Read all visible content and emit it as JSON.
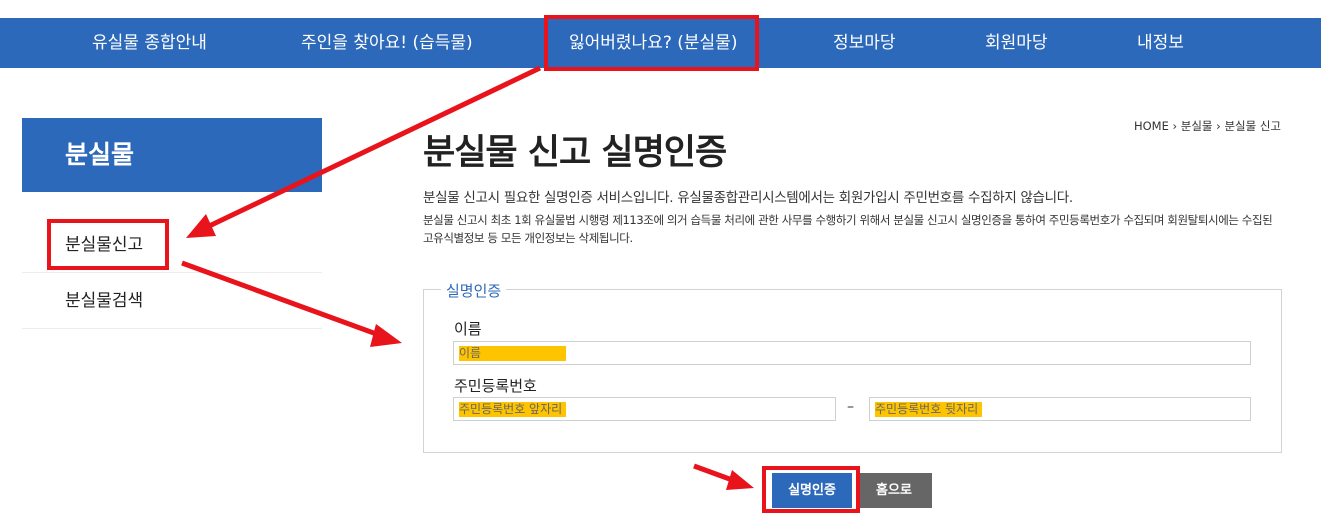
{
  "nav": {
    "items": [
      "유실물 종합안내",
      "주인을 찾아요! (습득물)",
      "잃어버렸나요? (분실물)",
      "정보마당",
      "회원마당",
      "내정보"
    ]
  },
  "sidebar": {
    "title": "분실물",
    "items": [
      "분실물신고",
      "분실물검색"
    ]
  },
  "breadcrumb": {
    "home": "HOME",
    "level1": "분실물",
    "level2": "분실물 신고",
    "separator": "›"
  },
  "page": {
    "title": "분실물 신고 실명인증",
    "desc1": "분실물 신고시 필요한 실명인증 서비스입니다. 유실물종합관리시스템에서는 회원가입시 주민번호를 수집하지 않습니다.",
    "desc2": "분실물 신고시 최초 1회 유실물법 시행령 제113조에 의거 습득물 처리에 관한 사무를 수행하기 위해서 분실물 신고시 실명인증을 통하여 주민등록번호가 수집되며 회원탈퇴시에는 수집된 고유식별정보 등 모든 개인정보는 삭제됩니다."
  },
  "form": {
    "legend": "실명인증",
    "name_label": "이름",
    "name_placeholder": "이름",
    "rrn_label": "주민등록번호",
    "rrn_front_placeholder": "주민등록번호 앞자리",
    "rrn_back_placeholder": "주민등록번호 뒷자리",
    "dash": "–"
  },
  "buttons": {
    "verify": "실명인증",
    "home": "홈으로"
  },
  "colors": {
    "brand_blue": "#2d69ba",
    "highlight_red": "#e8131b",
    "placeholder_highlight": "#ffc400",
    "button_gray": "#666666"
  }
}
